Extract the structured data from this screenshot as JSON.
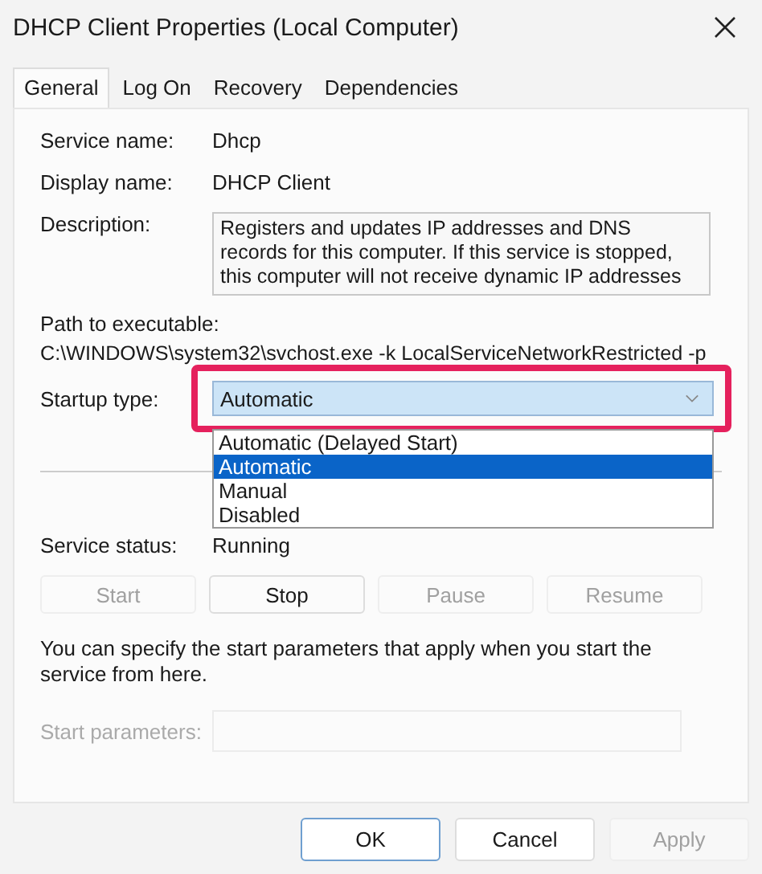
{
  "window": {
    "title": "DHCP Client Properties (Local Computer)"
  },
  "tabs": [
    {
      "label": "General",
      "selected": true
    },
    {
      "label": "Log On",
      "selected": false
    },
    {
      "label": "Recovery",
      "selected": false
    },
    {
      "label": "Dependencies",
      "selected": false
    }
  ],
  "info": [
    {
      "label": "Service name:",
      "value": "Dhcp"
    },
    {
      "label": "Display name:",
      "value": "DHCP Client"
    }
  ],
  "description": {
    "label": "Description:",
    "value": "Registers and updates IP addresses and DNS records for this computer. If this service is stopped, this computer will not receive dynamic IP addresses"
  },
  "path": {
    "label": "Path to executable:",
    "value": "C:\\WINDOWS\\system32\\svchost.exe -k LocalServiceNetworkRestricted -p"
  },
  "startup_type": {
    "label": "Startup type:",
    "value": "Automatic",
    "highlighted": true,
    "expanded": true,
    "options": [
      {
        "label": "Automatic (Delayed Start)",
        "selected": false
      },
      {
        "label": "Automatic",
        "selected": true
      },
      {
        "label": "Manual",
        "selected": false
      },
      {
        "label": "Disabled",
        "selected": false
      }
    ]
  },
  "service_status": {
    "label": "Service status:",
    "value": "Running"
  },
  "service_buttons": [
    {
      "label": "Start",
      "disabled": true
    },
    {
      "label": "Stop",
      "disabled": false
    },
    {
      "label": "Pause",
      "disabled": true
    },
    {
      "label": "Resume",
      "disabled": true
    }
  ],
  "note": "You can specify the start parameters that apply when you start the service from here.",
  "start_parameters": {
    "label": "Start parameters:",
    "disabled": true
  },
  "footer_buttons": [
    {
      "label": "OK",
      "default": true,
      "disabled": false
    },
    {
      "label": "Cancel",
      "default": false,
      "disabled": false
    },
    {
      "label": "Apply",
      "default": false,
      "disabled": true
    }
  ]
}
